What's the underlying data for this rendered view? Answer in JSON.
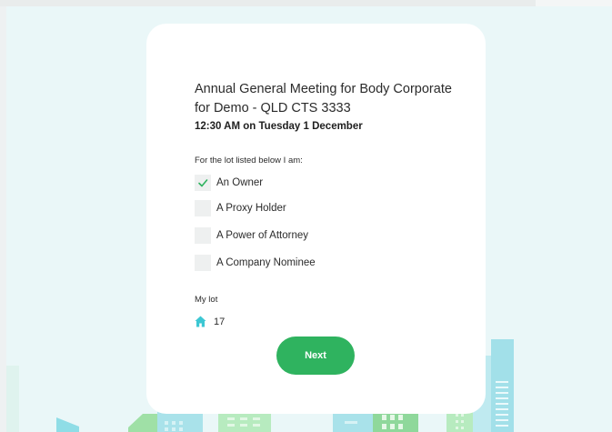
{
  "meeting": {
    "title": "Annual General Meeting for Body Corporate for Demo - QLD CTS 3333",
    "datetime": "12:30 AM on Tuesday 1 December"
  },
  "role_selection": {
    "prompt": "For the lot listed below I am:",
    "options": [
      {
        "label": "An Owner",
        "checked": true
      },
      {
        "label": "A Proxy Holder",
        "checked": false
      },
      {
        "label": "A Power of Attorney",
        "checked": false
      },
      {
        "label": "A Company Nominee",
        "checked": false
      }
    ]
  },
  "lot": {
    "heading": "My lot",
    "icon": "home-icon",
    "number": "17"
  },
  "actions": {
    "next_label": "Next"
  },
  "colors": {
    "accent_green": "#2fb35f",
    "check_green": "#2fb35f",
    "home_icon_teal": "#3cc7d3",
    "page_background": "#eaf7f8"
  }
}
